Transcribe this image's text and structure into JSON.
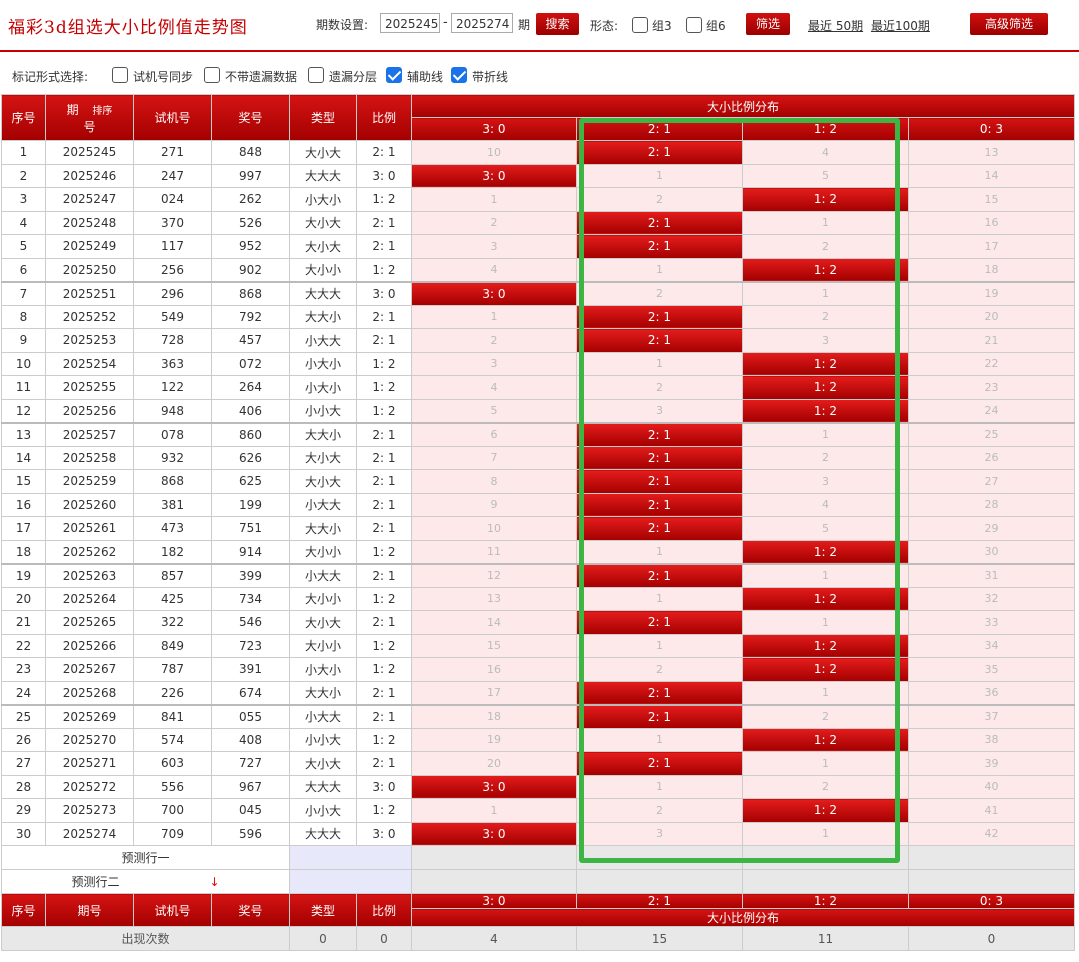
{
  "header": {
    "title": "福彩3d组选大小比例值走势图",
    "period_label": "期数设置:",
    "period_from": "2025245",
    "period_to": "2025274",
    "period_unit": "期",
    "search_label": "搜索",
    "form_label": "形态:",
    "group3_label": "组3",
    "group6_label": "组6",
    "filter_label": "筛选",
    "recent50_label": "最近 50期",
    "recent100_label": "最近100期",
    "advanced_label": "高级筛选"
  },
  "options": {
    "label": "标记形式选择:",
    "items": [
      {
        "label": "试机号同步",
        "checked": false
      },
      {
        "label": "不带遗漏数据",
        "checked": false
      },
      {
        "label": "遗漏分层",
        "checked": false
      },
      {
        "label": "辅助线",
        "checked": true
      },
      {
        "label": "带折线",
        "checked": true
      }
    ]
  },
  "table": {
    "headers": {
      "idx": "序号",
      "period_top": "期",
      "period_bottom": "号",
      "sort": "排序",
      "test": "试机号",
      "prize": "奖号",
      "type": "类型",
      "ratio": "比例",
      "dist": "大小比例分布",
      "dist_cols": [
        "3: 0",
        "2: 1",
        "1: 2",
        "0: 3"
      ],
      "period": "期号"
    },
    "rows": [
      {
        "idx": "1",
        "period": "2025245",
        "test": "271",
        "prize": "848",
        "type": "大小大",
        "ratio": "2: 1",
        "d": [
          "10",
          "2: 1",
          "4",
          "13"
        ],
        "hit": 1
      },
      {
        "idx": "2",
        "period": "2025246",
        "test": "247",
        "prize": "997",
        "type": "大大大",
        "ratio": "3: 0",
        "d": [
          "3: 0",
          "1",
          "5",
          "14"
        ],
        "hit": 0
      },
      {
        "idx": "3",
        "period": "2025247",
        "test": "024",
        "prize": "262",
        "type": "小大小",
        "ratio": "1: 2",
        "d": [
          "1",
          "2",
          "1: 2",
          "15"
        ],
        "hit": 2
      },
      {
        "idx": "4",
        "period": "2025248",
        "test": "370",
        "prize": "526",
        "type": "大小大",
        "ratio": "2: 1",
        "d": [
          "2",
          "2: 1",
          "1",
          "16"
        ],
        "hit": 1
      },
      {
        "idx": "5",
        "period": "2025249",
        "test": "117",
        "prize": "952",
        "type": "大小大",
        "ratio": "2: 1",
        "d": [
          "3",
          "2: 1",
          "2",
          "17"
        ],
        "hit": 1
      },
      {
        "idx": "6",
        "period": "2025250",
        "test": "256",
        "prize": "902",
        "type": "大小小",
        "ratio": "1: 2",
        "d": [
          "4",
          "1",
          "1: 2",
          "18"
        ],
        "hit": 2
      },
      {
        "idx": "7",
        "period": "2025251",
        "test": "296",
        "prize": "868",
        "type": "大大大",
        "ratio": "3: 0",
        "d": [
          "3: 0",
          "2",
          "1",
          "19"
        ],
        "hit": 0
      },
      {
        "idx": "8",
        "period": "2025252",
        "test": "549",
        "prize": "792",
        "type": "大大小",
        "ratio": "2: 1",
        "d": [
          "1",
          "2: 1",
          "2",
          "20"
        ],
        "hit": 1
      },
      {
        "idx": "9",
        "period": "2025253",
        "test": "728",
        "prize": "457",
        "type": "小大大",
        "ratio": "2: 1",
        "d": [
          "2",
          "2: 1",
          "3",
          "21"
        ],
        "hit": 1
      },
      {
        "idx": "10",
        "period": "2025254",
        "test": "363",
        "prize": "072",
        "type": "小大小",
        "ratio": "1: 2",
        "d": [
          "3",
          "1",
          "1: 2",
          "22"
        ],
        "hit": 2
      },
      {
        "idx": "11",
        "period": "2025255",
        "test": "122",
        "prize": "264",
        "type": "小大小",
        "ratio": "1: 2",
        "d": [
          "4",
          "2",
          "1: 2",
          "23"
        ],
        "hit": 2
      },
      {
        "idx": "12",
        "period": "2025256",
        "test": "948",
        "prize": "406",
        "type": "小小大",
        "ratio": "1: 2",
        "d": [
          "5",
          "3",
          "1: 2",
          "24"
        ],
        "hit": 2
      },
      {
        "idx": "13",
        "period": "2025257",
        "test": "078",
        "prize": "860",
        "type": "大大小",
        "ratio": "2: 1",
        "d": [
          "6",
          "2: 1",
          "1",
          "25"
        ],
        "hit": 1
      },
      {
        "idx": "14",
        "period": "2025258",
        "test": "932",
        "prize": "626",
        "type": "大小大",
        "ratio": "2: 1",
        "d": [
          "7",
          "2: 1",
          "2",
          "26"
        ],
        "hit": 1
      },
      {
        "idx": "15",
        "period": "2025259",
        "test": "868",
        "prize": "625",
        "type": "大小大",
        "ratio": "2: 1",
        "d": [
          "8",
          "2: 1",
          "3",
          "27"
        ],
        "hit": 1
      },
      {
        "idx": "16",
        "period": "2025260",
        "test": "381",
        "prize": "199",
        "type": "小大大",
        "ratio": "2: 1",
        "d": [
          "9",
          "2: 1",
          "4",
          "28"
        ],
        "hit": 1
      },
      {
        "idx": "17",
        "period": "2025261",
        "test": "473",
        "prize": "751",
        "type": "大大小",
        "ratio": "2: 1",
        "d": [
          "10",
          "2: 1",
          "5",
          "29"
        ],
        "hit": 1
      },
      {
        "idx": "18",
        "period": "2025262",
        "test": "182",
        "prize": "914",
        "type": "大小小",
        "ratio": "1: 2",
        "d": [
          "11",
          "1",
          "1: 2",
          "30"
        ],
        "hit": 2
      },
      {
        "idx": "19",
        "period": "2025263",
        "test": "857",
        "prize": "399",
        "type": "小大大",
        "ratio": "2: 1",
        "d": [
          "12",
          "2: 1",
          "1",
          "31"
        ],
        "hit": 1
      },
      {
        "idx": "20",
        "period": "2025264",
        "test": "425",
        "prize": "734",
        "type": "大小小",
        "ratio": "1: 2",
        "d": [
          "13",
          "1",
          "1: 2",
          "32"
        ],
        "hit": 2
      },
      {
        "idx": "21",
        "period": "2025265",
        "test": "322",
        "prize": "546",
        "type": "大小大",
        "ratio": "2: 1",
        "d": [
          "14",
          "2: 1",
          "1",
          "33"
        ],
        "hit": 1
      },
      {
        "idx": "22",
        "period": "2025266",
        "test": "849",
        "prize": "723",
        "type": "大小小",
        "ratio": "1: 2",
        "d": [
          "15",
          "1",
          "1: 2",
          "34"
        ],
        "hit": 2
      },
      {
        "idx": "23",
        "period": "2025267",
        "test": "787",
        "prize": "391",
        "type": "小大小",
        "ratio": "1: 2",
        "d": [
          "16",
          "2",
          "1: 2",
          "35"
        ],
        "hit": 2
      },
      {
        "idx": "24",
        "period": "2025268",
        "test": "226",
        "prize": "674",
        "type": "大大小",
        "ratio": "2: 1",
        "d": [
          "17",
          "2: 1",
          "1",
          "36"
        ],
        "hit": 1
      },
      {
        "idx": "25",
        "period": "2025269",
        "test": "841",
        "prize": "055",
        "type": "小大大",
        "ratio": "2: 1",
        "d": [
          "18",
          "2: 1",
          "2",
          "37"
        ],
        "hit": 1
      },
      {
        "idx": "26",
        "period": "2025270",
        "test": "574",
        "prize": "408",
        "type": "小小大",
        "ratio": "1: 2",
        "d": [
          "19",
          "1",
          "1: 2",
          "38"
        ],
        "hit": 2
      },
      {
        "idx": "27",
        "period": "2025271",
        "test": "603",
        "prize": "727",
        "type": "大小大",
        "ratio": "2: 1",
        "d": [
          "20",
          "2: 1",
          "1",
          "39"
        ],
        "hit": 1
      },
      {
        "idx": "28",
        "period": "2025272",
        "test": "556",
        "prize": "967",
        "type": "大大大",
        "ratio": "3: 0",
        "d": [
          "3: 0",
          "1",
          "2",
          "40"
        ],
        "hit": 0
      },
      {
        "idx": "29",
        "period": "2025273",
        "test": "700",
        "prize": "045",
        "type": "小小大",
        "ratio": "1: 2",
        "d": [
          "1",
          "2",
          "1: 2",
          "41"
        ],
        "hit": 2
      },
      {
        "idx": "30",
        "period": "2025274",
        "test": "709",
        "prize": "596",
        "type": "大大大",
        "ratio": "3: 0",
        "d": [
          "3: 0",
          "3",
          "1",
          "42"
        ],
        "hit": 0
      }
    ],
    "predict1": "预测行一",
    "predict2": "预测行二",
    "stats_label": "出现次数",
    "stats": [
      "0",
      "0",
      "4",
      "15",
      "11",
      "0"
    ]
  },
  "colors": {
    "accent": "#c40000",
    "highlight_box": "#3cb544",
    "checkbox_on": "#1a73e8"
  }
}
